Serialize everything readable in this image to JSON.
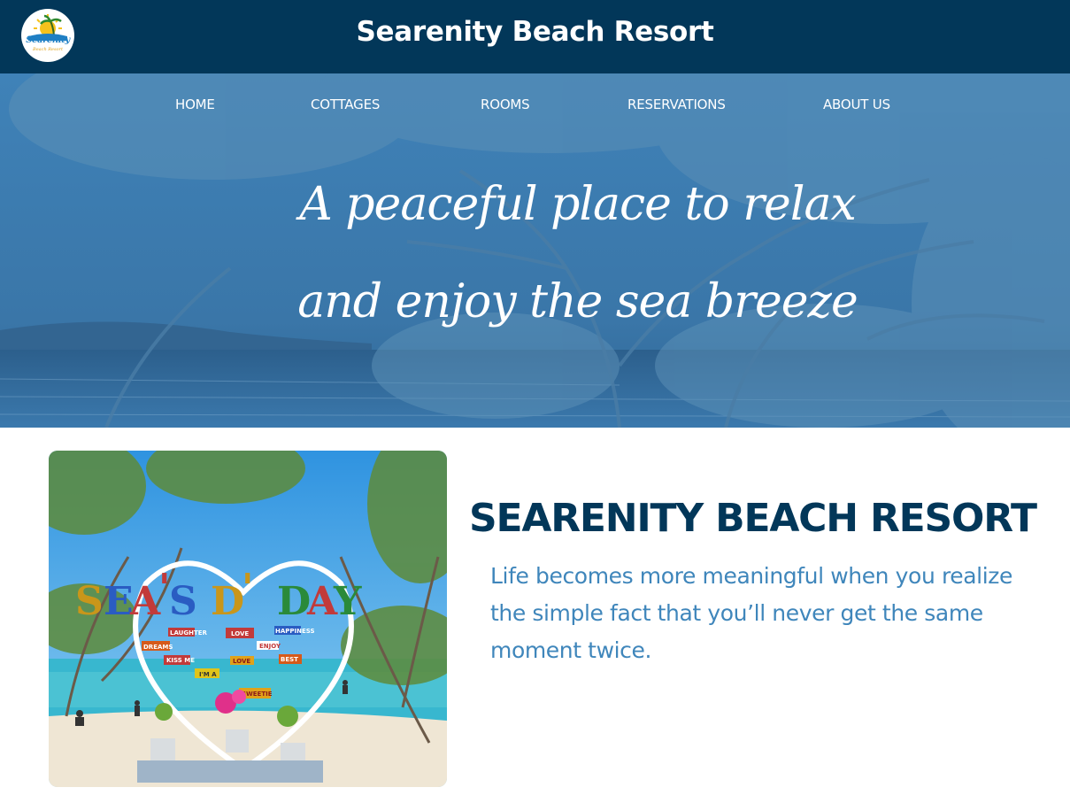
{
  "header": {
    "site_title": "Searenity Beach Resort",
    "logo": {
      "text": "Searenity",
      "subtext": "Beach Resort"
    }
  },
  "nav": {
    "items": [
      {
        "label": "HOME"
      },
      {
        "label": "COTTAGES"
      },
      {
        "label": "ROOMS"
      },
      {
        "label": "RESERVATIONS"
      },
      {
        "label": "ABOUT US"
      }
    ]
  },
  "hero": {
    "tagline_line1": "A peaceful place to relax",
    "tagline_line2": "and enjoy the sea breeze"
  },
  "about": {
    "photo_sign": {
      "letters": [
        "S",
        "E",
        "A",
        "'",
        "S",
        "D",
        "'",
        "D",
        "A",
        "Y"
      ],
      "boards": [
        "LAUGHTER",
        "LOVE",
        "HAPPINESS",
        "DREAMS",
        "ENJOY",
        "KISS ME",
        "LOVE",
        "BEST",
        "I'M A",
        "SWEETIE"
      ]
    },
    "title": "SEARENITY BEACH RESORT",
    "text": "Life becomes more meaningful when you realize the simple fact that you’ll never get the same moment twice."
  },
  "colors": {
    "header_bg": "#023759",
    "title_text": "#023759",
    "body_text": "#3f86bb",
    "hero_overlay": "#2f6fa3"
  }
}
